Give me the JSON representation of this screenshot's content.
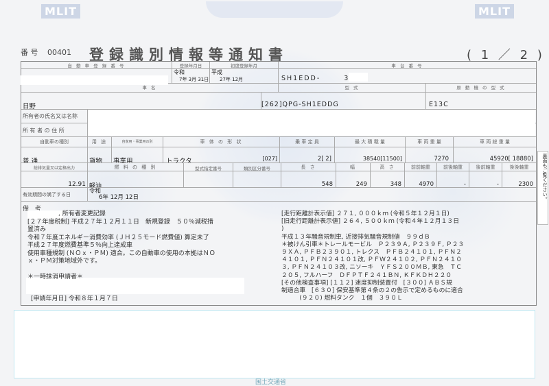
{
  "header": {
    "logo_left": "MLIT",
    "logo_right": "MLIT",
    "number_label": "番 号",
    "number_value": "00401",
    "title": "登録識別情報等通知書",
    "page_indicator": "( 1 ／ 2 )"
  },
  "headers": {
    "reg_no": "自 動 車 登 録 番 号",
    "reg_date": "登録年月日",
    "first_reg": "初度登録年月",
    "chassis": "車 台 番 号",
    "name": "車 名",
    "model": "型 式",
    "engine": "原 動 機 の 型 式",
    "owner_name": "所有者の氏名又は名称",
    "owner_addr": "所 有 者 の 住 所",
    "kind": "自動車の種別",
    "use": "用 途",
    "sub_use": "自家用・事業用の別",
    "body": "車 体 の 形 状",
    "capacity": "乗 車 定 員",
    "max_load": "最 大 積 載 量",
    "weight": "車 両 重 量",
    "gross_weight": "車 両 総 重 量",
    "displacement": "総排気量又は定格出力",
    "fuel": "燃 料 の 種 別",
    "type_no": "型式指定番号",
    "class_no": "類別区分番号",
    "length": "長 さ",
    "width": "幅",
    "height": "高 さ",
    "ff_axle": "前前軸重",
    "fr_axle": "前後軸重",
    "rf_axle": "後前軸重",
    "rr_axle": "後後軸重",
    "expiry": "有効期間の満了する日",
    "remarks": "備 考"
  },
  "values": {
    "reg_era": "令和",
    "reg_date": "7年 3月 31日",
    "first_era": "平成",
    "first_date": "27年 12月",
    "chassis_no": "SH1EDD-",
    "chassis_tail": "328",
    "maker": "日野",
    "model": "[262]QPG-SH1EDDG",
    "engine": "E13C",
    "kind": "普 通",
    "use": "貨物",
    "sub_use": "事業用",
    "body": "トラクタ",
    "body_code": "[027]",
    "capacity": "2[ 2]",
    "max_load": "38540[11500]",
    "weight": "7270",
    "gross_weight": "45920[ 18880]",
    "displacement": "12.91",
    "fuel": "軽油",
    "length": "548",
    "width": "249",
    "height": "348",
    "ff_axle": "4970",
    "fr_axle": "-",
    "rf_axle": "-",
    "rr_axle": "2300",
    "expiry_era": "令和",
    "expiry_date": "6年 12月 12日"
  },
  "remarks_left": "　　　　　, 所有者変更記録\n[２７年度税制] 平成２７年１２月１１日　新規登録　５０％減税措\n置済み\n令和７年度エネルギー消費効率 (ＪＨ２５モード燃費値) 算定未了\n平成２７年度燃費基準５％向上達成車\n使用車種規制 (ＮＯｘ・ＰＭ) 適合。この自動車の使用の本拠はＮＯ\nｘ・ＰＭ対策地域外です。\n\n＊一時抹消申請者＊",
  "application_date": "[申請年月日] 令和８年１月７日",
  "remarks_right": "[走行距離計表示値] ２７１, ０００ｋｍ (令和５年１２月１日)\n[旧走行距離計表示値] ２６４, ５００ｋｍ (令和４年１２月１３日\n)\n平成１３年騒音規制車, 近接排気騒音規制値　９９ｄＢ\n＊被けん引車＊トレールモービル　Ｐ２３９Ａ, Ｐ２３９Ｆ, Ｐ２３\n９ＸＡ, ＰＦＢ２３９０１, トレクス　ＰＦＢ２４１０１, ＰＦＮ２\n４１０１, ＰＦＮ２４１０１改, ＰＦＷ２４１０２, ＰＦＮ２４１０\n３, ＰＦＮ２４１０３改, ニソーキ　ＹＦＳ２００ＭＢ, 東急　ＴＣ\n２０５, フルハーフ　ＤＦＰＴＦ２４１ＢＮ, ＫＦＫＤＨ２２０\n[その他検査事項] [１１２] 速度抑制装置付　[３００] ＡＢＳ規\n制適合車　[６３０] 保安基準第４条の２の告示で定めるものに適合\n　　　(９２０) 燃料タンク　１個　３９０Ｌ",
  "side_note": "裏面もご覧ください。",
  "footer": "国土交通省"
}
